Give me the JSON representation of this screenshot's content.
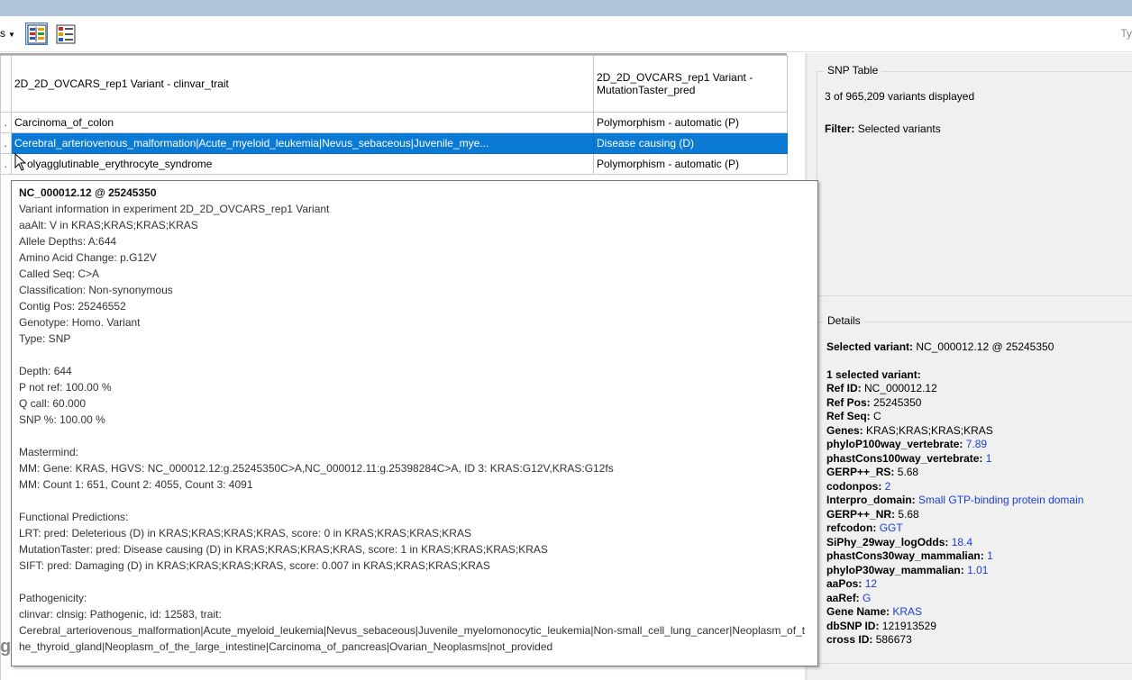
{
  "toolbar": {
    "menu_fragment": "s",
    "right_fragment": "Ty",
    "colors": {
      "button_active_border": "#3b79c8"
    },
    "buttons": [
      {
        "icon": "snp-filter-toggle-icon",
        "active": true
      },
      {
        "icon": "color-legend-icon",
        "active": false
      }
    ]
  },
  "grid": {
    "columns": [
      "2D_2D_OVCARS_rep1 Variant - clinvar_trait",
      "2D_2D_OVCARS_rep1 Variant - MutationTaster_pred"
    ],
    "rows": [
      {
        "lead": ".",
        "trait": "Carcinoma_of_colon",
        "pred": "Polymorphism - automatic (P)"
      },
      {
        "lead": ".",
        "trait": "Cerebral_arteriovenous_malformation|Acute_myeloid_leukemia|Nevus_sebaceous|Juvenile_mye...",
        "pred": "Disease causing (D)",
        "selected": true
      },
      {
        "lead": ".",
        "trait": "olyagglutinable_erythrocyte_syndrome",
        "pred": "Polymorphism - automatic (P)"
      }
    ],
    "selected_color": "#0a7ad4"
  },
  "side_fragment": "g",
  "tooltip": {
    "title": "NC_000012.12 @ 25245350",
    "lines_1": [
      "Variant information in experiment 2D_2D_OVCARS_rep1 Variant",
      "aaAlt: V in KRAS;KRAS;KRAS;KRAS",
      "Allele Depths: A:644",
      "Amino Acid Change: p.G12V",
      "Called Seq: C>A",
      "Classification: Non-synonymous",
      "Contig Pos: 25246552",
      "Genotype: Homo. Variant",
      "Type: SNP"
    ],
    "lines_2": [
      "Depth: 644",
      "P not ref: 100.00 %",
      "Q call: 60.000",
      "SNP %: 100.00 %"
    ],
    "lines_3": [
      "Mastermind:",
      "MM: Gene: KRAS, HGVS: NC_000012.12:g.25245350C>A,NC_000012.11:g.25398284C>A, ID 3: KRAS:G12V,KRAS:G12fs",
      "MM: Count 1: 651, Count 2: 4055, Count 3: 4091"
    ],
    "lines_4": [
      "Functional Predictions:",
      "LRT: pred: Deleterious (D) in KRAS;KRAS;KRAS;KRAS, score: 0 in KRAS;KRAS;KRAS;KRAS",
      "MutationTaster: pred: Disease causing (D) in KRAS;KRAS;KRAS;KRAS, score: 1 in KRAS;KRAS;KRAS;KRAS",
      "SIFT: pred: Damaging (D) in KRAS;KRAS;KRAS;KRAS, score: 0.007 in KRAS;KRAS;KRAS;KRAS"
    ],
    "pathogenicity_heading": "Pathogenicity:",
    "pathogenicity_line": "clinvar: clnsig: Pathogenic, id: 12583, trait:",
    "pathogenicity_traits": "Cerebral_arteriovenous_malformation|Acute_myeloid_leukemia|Nevus_sebaceous|Juvenile_myelomonocytic_leukemia|Non-small_cell_lung_cancer|Neoplasm_of_the_thyroid_gland|Neoplasm_of_the_large_intestine|Carcinoma_of_pancreas|Ovarian_Neoplasms|not_provided"
  },
  "snp_table": {
    "title": "SNP Table",
    "count_text": "3 of 965,209 variants displayed",
    "filter_label": "Filter:",
    "filter_value": "Selected variants"
  },
  "details": {
    "title": "Details",
    "selected_label": "Selected variant:",
    "selected_value": "NC_000012.12 @ 25245350",
    "count_heading": "1 selected variant:",
    "fields": [
      {
        "key": "Ref ID:",
        "value": "NC_000012.12",
        "link": false
      },
      {
        "key": "Ref Pos:",
        "value": "25245350",
        "link": false
      },
      {
        "key": "Ref Seq:",
        "value": "C",
        "link": false
      },
      {
        "key": "Genes:",
        "value": "KRAS;KRAS;KRAS;KRAS",
        "link": false
      },
      {
        "key": "phyloP100way_vertebrate:",
        "value": "7.89",
        "link": true
      },
      {
        "key": "phastCons100way_vertebrate:",
        "value": "1",
        "link": true
      },
      {
        "key": "GERP++_RS:",
        "value": "5.68",
        "link": false
      },
      {
        "key": "codonpos:",
        "value": "2",
        "link": true
      },
      {
        "key": "Interpro_domain:",
        "value": "Small GTP-binding protein domain",
        "link": true
      },
      {
        "key": "GERP++_NR:",
        "value": "5.68",
        "link": false
      },
      {
        "key": "refcodon:",
        "value": "GGT",
        "link": true
      },
      {
        "key": "SiPhy_29way_logOdds:",
        "value": "18.4",
        "link": true
      },
      {
        "key": "phastCons30way_mammalian:",
        "value": "1",
        "link": true
      },
      {
        "key": "phyloP30way_mammalian:",
        "value": "1.01",
        "link": true
      },
      {
        "key": "aaPos:",
        "value": "12",
        "link": true
      },
      {
        "key": "aaRef:",
        "value": "G",
        "link": true
      },
      {
        "key": "Gene Name:",
        "value": "KRAS",
        "link": true
      },
      {
        "key": "dbSNP ID:",
        "value": "121913529",
        "link": false
      },
      {
        "key": "cross ID:",
        "value": "586673",
        "link": false
      }
    ],
    "link_color": "#1a3fd4"
  }
}
